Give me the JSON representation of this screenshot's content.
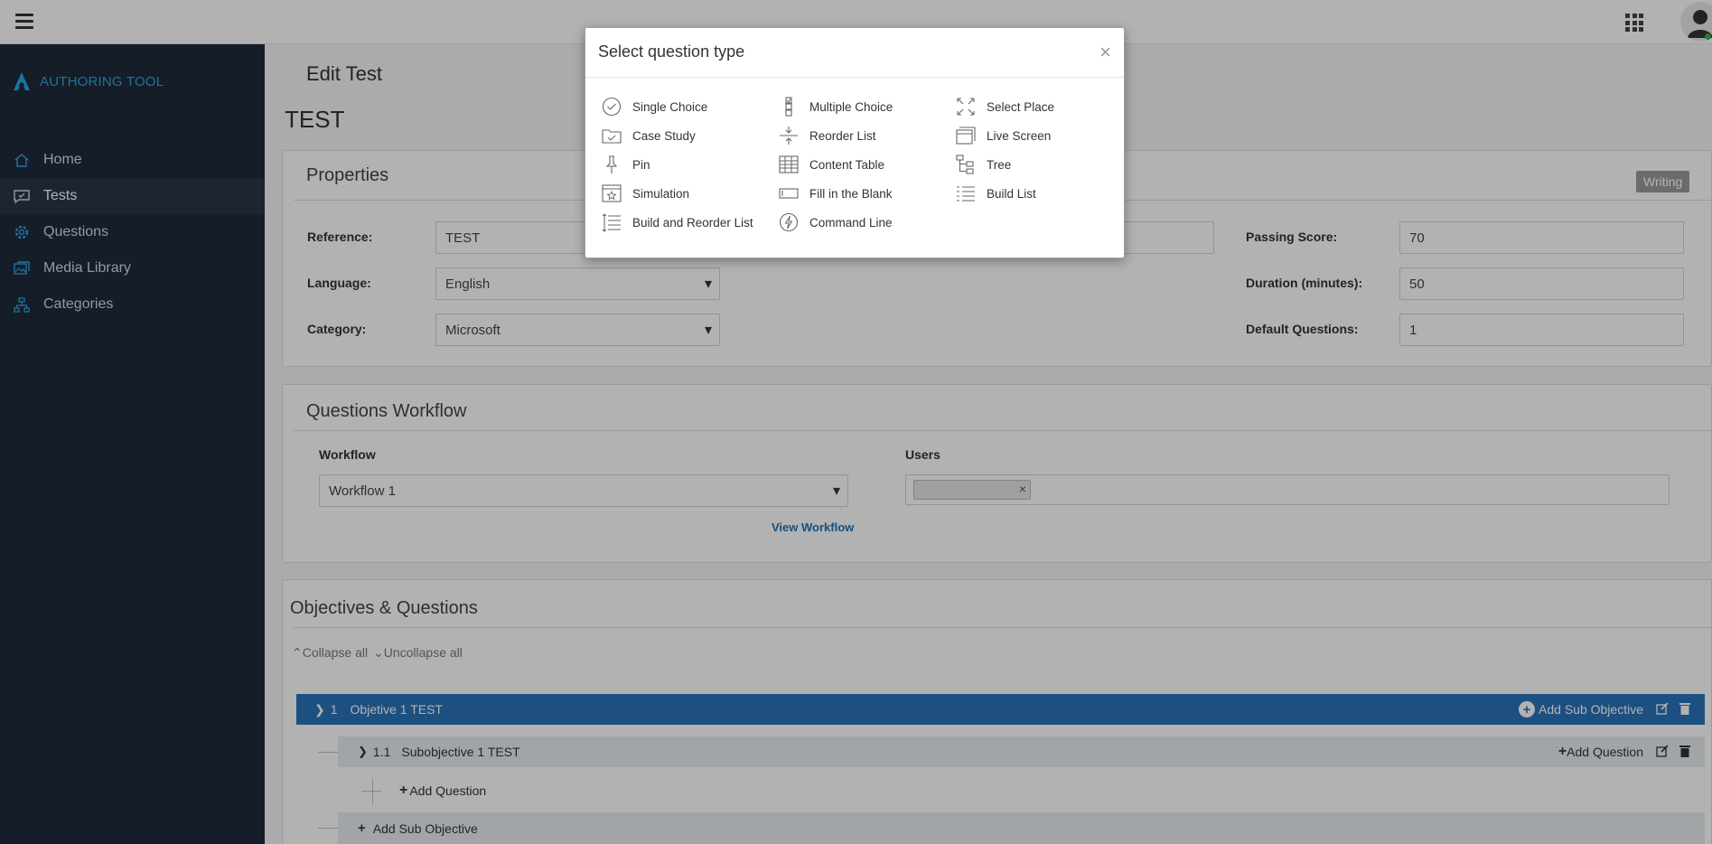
{
  "brand": {
    "name": "AUTHORING TOOL"
  },
  "nav": {
    "items": [
      {
        "label": "Home",
        "icon": "home-icon",
        "active": false
      },
      {
        "label": "Tests",
        "icon": "chat-check-icon",
        "active": true
      },
      {
        "label": "Questions",
        "icon": "gear-icon",
        "active": false
      },
      {
        "label": "Media Library",
        "icon": "image-icon",
        "active": false
      },
      {
        "label": "Categories",
        "icon": "sitemap-icon",
        "active": false
      }
    ]
  },
  "page": {
    "title": "Edit Test",
    "test_name": "TEST"
  },
  "properties": {
    "title": "Properties",
    "status": "Writing",
    "reference_label": "Reference:",
    "reference_value": "TEST",
    "language_label": "Language:",
    "language_value": "English",
    "category_label": "Category:",
    "category_value": "Microsoft",
    "passing_label": "Passing Score:",
    "passing_value": "70",
    "duration_label": "Duration (minutes):",
    "duration_value": "50",
    "default_q_label": "Default Questions:",
    "default_q_value": "1"
  },
  "workflow": {
    "title": "Questions Workflow",
    "workflow_label": "Workflow",
    "workflow_value": "Workflow 1",
    "view_link": "View Workflow",
    "users_label": "Users",
    "chip_remove": "×"
  },
  "objectives": {
    "title": "Objectives & Questions",
    "collapse_all": "Collapse all",
    "uncollapse_all": "Uncollapse all",
    "objective_number": "1",
    "objective_name": "Objetive 1 TEST",
    "add_sub_objective": "Add Sub Objective",
    "sub_number": "1.1",
    "sub_name": "Subobjective 1 TEST",
    "add_question_btn": "Add Question",
    "add_question": "Add Question",
    "add_sub_objective_row": "Add Sub Objective"
  },
  "modal": {
    "title": "Select question type",
    "close": "×",
    "items": [
      {
        "label": "Single Choice",
        "icon": "check-circle-icon"
      },
      {
        "label": "Multiple Choice",
        "icon": "stacked-checkbox-icon"
      },
      {
        "label": "Select Place",
        "icon": "expand-arrows-icon"
      },
      {
        "label": "Case Study",
        "icon": "folder-check-icon"
      },
      {
        "label": "Reorder List",
        "icon": "reorder-arrows-icon"
      },
      {
        "label": "Live Screen",
        "icon": "window-stack-icon"
      },
      {
        "label": "Pin",
        "icon": "pin-icon"
      },
      {
        "label": "Content Table",
        "icon": "table-icon"
      },
      {
        "label": "Tree",
        "icon": "tree-icon"
      },
      {
        "label": "Simulation",
        "icon": "star-window-icon"
      },
      {
        "label": "Fill in the Blank",
        "icon": "text-field-icon"
      },
      {
        "label": "Build List",
        "icon": "build-list-icon"
      },
      {
        "label": "Build and Reorder List",
        "icon": "list-reorder-icon"
      },
      {
        "label": "Command Line",
        "icon": "bolt-circle-icon"
      }
    ]
  }
}
